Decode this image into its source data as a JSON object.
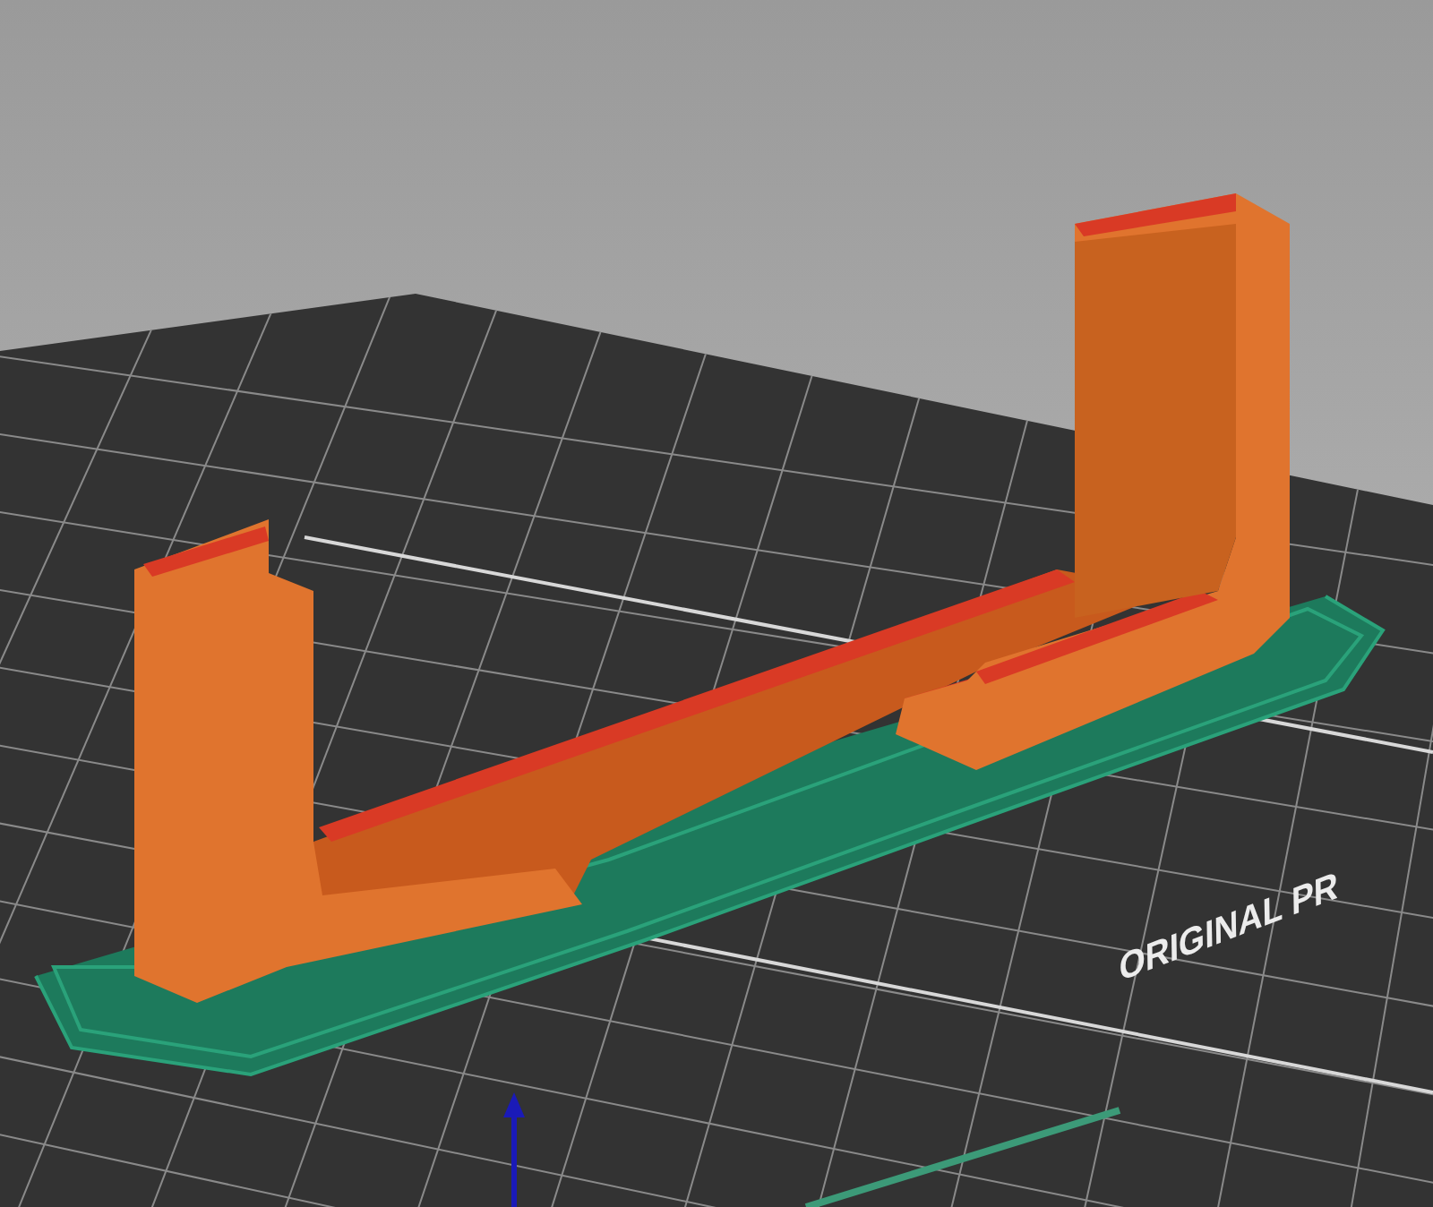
{
  "viewport": {
    "bed_label": "ORIGINAL PR"
  }
}
